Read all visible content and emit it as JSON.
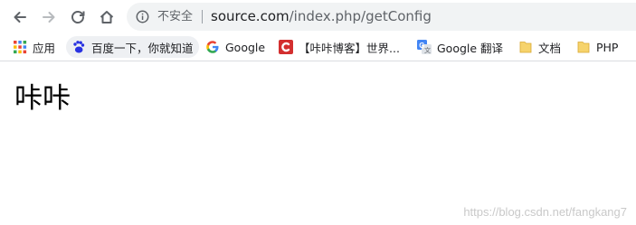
{
  "address_bar": {
    "security_label": "不安全",
    "url_host": "source.com",
    "url_path": "/index.php/getConfig"
  },
  "bookmarks": {
    "apps_label": "应用",
    "items": [
      {
        "label": "百度一下，你就知道",
        "icon": "baidu-paw-icon"
      },
      {
        "label": "Google",
        "icon": "google-g-icon"
      },
      {
        "label": "【咔咔博客】世界...",
        "icon": "kaka-blog-icon"
      },
      {
        "label": "Google 翻译",
        "icon": "google-translate-icon"
      },
      {
        "label": "文档",
        "icon": "folder-icon"
      },
      {
        "label": "PHP",
        "icon": "folder-icon"
      }
    ]
  },
  "page": {
    "heading": "咔咔"
  },
  "watermark": "https://blog.csdn.net/fangkang7",
  "colors": {
    "omnibox_bg": "#f1f3f4",
    "google_blue": "#4285f4",
    "kaka_red": "#d32f2f",
    "folder_yellow": "#f6d36c"
  }
}
